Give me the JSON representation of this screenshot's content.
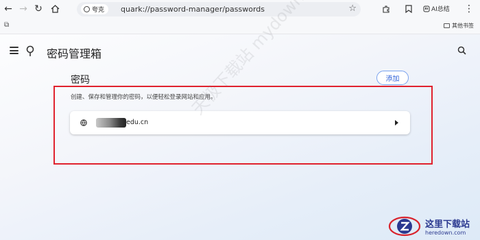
{
  "browser": {
    "site_chip": "夸克",
    "url": "quark://password-manager/passwords",
    "ai_label": "AI总结",
    "bookmarks_folder": "其他书签"
  },
  "app": {
    "title": "密码管理箱"
  },
  "section": {
    "title": "密码",
    "add_label": "添加",
    "description": "创建、保存和管理你的密码，以便轻松登录网站和应用。"
  },
  "passwords": [
    {
      "site_suffix": "edu.cn"
    }
  ],
  "watermark": "天极下载站 mydown.yesky.com",
  "logo": {
    "title": "这里下载站",
    "subtitle": "heredown.com"
  },
  "colors": {
    "accent": "#2f62d8",
    "highlight": "#e0212d"
  }
}
